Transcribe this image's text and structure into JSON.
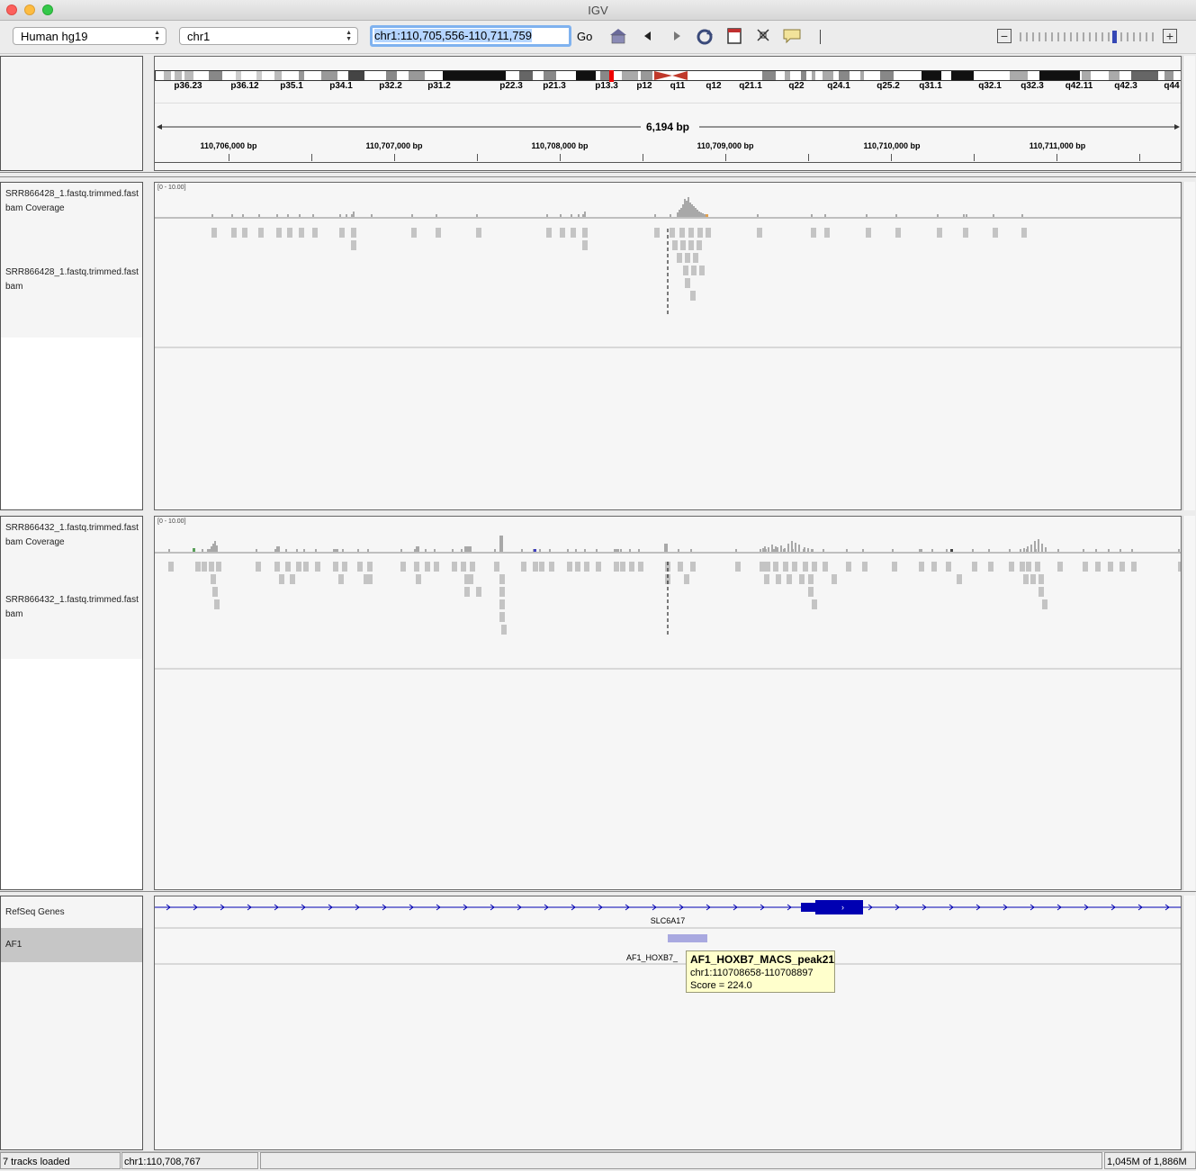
{
  "window": {
    "title": "IGV"
  },
  "toolbar": {
    "genome": "Human hg19",
    "chromosome": "chr1",
    "locus": "chr1:110,705,556-110,711,759",
    "go_label": "Go",
    "zoom_minus": "−",
    "zoom_plus": "+"
  },
  "ideogram": {
    "bands": [
      "p36.23",
      "p36.12",
      "p35.1",
      "p34.1",
      "p32.2",
      "p31.2",
      "p22.3",
      "p21.3",
      "p13.3",
      "p12",
      "q11",
      "q12",
      "q21.1",
      "q22",
      "q24.1",
      "q25.2",
      "q31.1",
      "q32.1",
      "q32.3",
      "q42.11",
      "q42.3",
      "q44"
    ]
  },
  "ruler": {
    "span": "6,194 bp",
    "ticks": [
      "110,706,000 bp",
      "110,707,000 bp",
      "110,708,000 bp",
      "110,709,000 bp",
      "110,710,000 bp",
      "110,711,000 bp"
    ]
  },
  "tracks": {
    "cov1_name": "SRR866428_1.fastq.trimmed.fast bam Coverage",
    "cov1_line1": "SRR866428_1.fastq.trimmed.fast",
    "cov1_line2": "bam Coverage",
    "aln1_line1": "SRR866428_1.fastq.trimmed.fast",
    "aln1_line2": "bam",
    "cov1_scale": "[0 - 10.00]",
    "cov2_line1": "SRR866432_1.fastq.trimmed.fast",
    "cov2_line2": "bam Coverage",
    "aln2_line1": "SRR866432_1.fastq.trimmed.fast",
    "aln2_line2": "bam",
    "cov2_scale": "[0 - 10.00]",
    "refseq_name": "RefSeq Genes",
    "af1_name": "AF1",
    "gene_label": "SLC6A17",
    "peak_label": "AF1_HOXB7_"
  },
  "tooltip": {
    "title": "AF1_HOXB7_MACS_peak21",
    "locus": "chr1:110708658-110708897",
    "score": "Score = 224.0"
  },
  "status": {
    "tracks_loaded": "7 tracks loaded",
    "position": "chr1:110,708,767",
    "memory": "1,045M of 1,886M"
  },
  "colors": {
    "read": "#c0c0c0",
    "coverage": "#a8a8a8",
    "gene": "#0000b2",
    "peak": "#a9a9e0",
    "tooltip_bg": "#ffffcc",
    "locus_highlight": "#b5d5ff"
  }
}
